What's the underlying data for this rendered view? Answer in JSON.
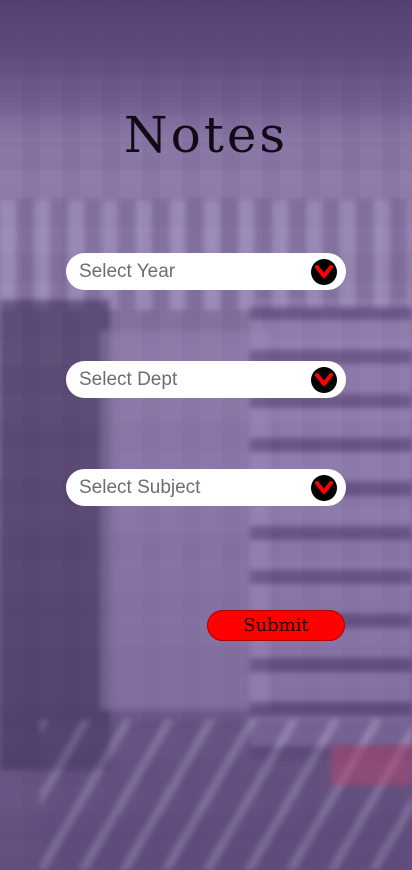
{
  "page": {
    "title": "Notes"
  },
  "form": {
    "year": {
      "placeholder": "Select Year"
    },
    "dept": {
      "placeholder": "Select Dept"
    },
    "subject": {
      "placeholder": "Select Subject"
    },
    "submit_label": "Submit"
  },
  "icons": {
    "dropdown": "chevron-down-icon"
  },
  "colors": {
    "overlay": "#7a6592",
    "submit": "#ff0000",
    "chevron": "#ff0000",
    "chevron_bg": "#000000",
    "field_bg": "#ffffff"
  }
}
